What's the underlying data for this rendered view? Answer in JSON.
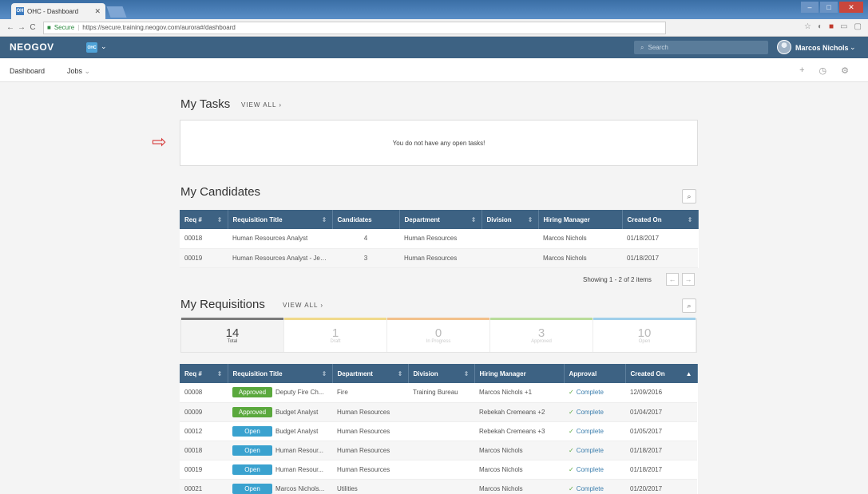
{
  "browser": {
    "tab_title": "OHC - Dashboard",
    "tab_favicon": "OH",
    "secure_label": "Secure",
    "url": "https://secure.training.neogov.com/aurora#/dashboard"
  },
  "app": {
    "logo": "NEOGOV",
    "org_badge": "OHC",
    "search_placeholder": "Search",
    "user_name": "Marcos Nichols"
  },
  "subnav": {
    "dashboard": "Dashboard",
    "jobs": "Jobs"
  },
  "tasks": {
    "title": "My Tasks",
    "view_all": "VIEW ALL",
    "empty_message": "You do not have any open tasks!"
  },
  "candidates": {
    "title": "My Candidates",
    "columns": [
      "Req #",
      "Requisition Title",
      "Candidates",
      "Department",
      "Division",
      "Hiring Manager",
      "Created On"
    ],
    "rows": [
      [
        "00018",
        "Human Resources Analyst",
        "4",
        "Human Resources",
        "",
        "Marcos Nichols",
        "01/18/2017"
      ],
      [
        "00019",
        "Human Resources Analyst - Jen...",
        "3",
        "Human Resources",
        "",
        "Marcos Nichols",
        "01/18/2017"
      ]
    ],
    "showing": "Showing 1 - 2 of 2 items"
  },
  "requisitions": {
    "title": "My Requisitions",
    "view_all": "VIEW ALL",
    "stats": [
      {
        "value": "14",
        "label": "Total",
        "color": "#7a7a7a"
      },
      {
        "value": "1",
        "label": "Draft",
        "color": "#f0d98a"
      },
      {
        "value": "0",
        "label": "In Progress",
        "color": "#f2c08a"
      },
      {
        "value": "3",
        "label": "Approved",
        "color": "#b9dc9a"
      },
      {
        "value": "10",
        "label": "Open",
        "color": "#9fcfea"
      }
    ],
    "columns": [
      "Req #",
      "Requisition Title",
      "Department",
      "Division",
      "Hiring Manager",
      "Approval",
      "Created On"
    ],
    "rows": [
      {
        "req": "00008",
        "status": "Approved",
        "title": "Deputy Fire Ch...",
        "department": "Fire",
        "division": "Training Bureau",
        "manager": "Marcos Nichols +1",
        "approval": "Complete",
        "created": "12/09/2016"
      },
      {
        "req": "00009",
        "status": "Approved",
        "title": "Budget Analyst",
        "department": "Human Resources",
        "division": "",
        "manager": "Rebekah Cremeans +2",
        "approval": "Complete",
        "created": "01/04/2017"
      },
      {
        "req": "00012",
        "status": "Open",
        "title": "Budget Analyst",
        "department": "Human Resources",
        "division": "",
        "manager": "Rebekah Cremeans +3",
        "approval": "Complete",
        "created": "01/05/2017"
      },
      {
        "req": "00018",
        "status": "Open",
        "title": "Human Resour...",
        "department": "Human Resources",
        "division": "",
        "manager": "Marcos Nichols",
        "approval": "Complete",
        "created": "01/18/2017"
      },
      {
        "req": "00019",
        "status": "Open",
        "title": "Human Resour...",
        "department": "Human Resources",
        "division": "",
        "manager": "Marcos Nichols",
        "approval": "Complete",
        "created": "01/18/2017"
      },
      {
        "req": "00021",
        "status": "Open",
        "title": "Marcos Nichols...",
        "department": "Utilities",
        "division": "",
        "manager": "Marcos Nichols",
        "approval": "Complete",
        "created": "01/20/2017"
      }
    ]
  }
}
